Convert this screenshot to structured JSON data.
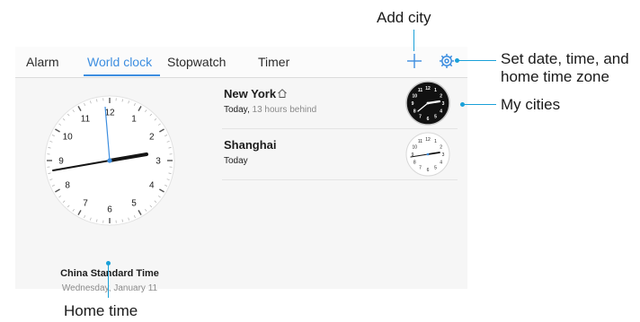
{
  "tabs": [
    {
      "label": "Alarm",
      "active": false
    },
    {
      "label": "World clock",
      "active": true
    },
    {
      "label": "Stopwatch",
      "active": false
    },
    {
      "label": "Timer",
      "active": false
    }
  ],
  "toolbar": {
    "add_icon": "plus-icon",
    "settings_icon": "gear-icon"
  },
  "home_clock": {
    "timezone": "China Standard Time",
    "date": "Wednesday, January 11",
    "numbers": [
      "12",
      "1",
      "2",
      "3",
      "4",
      "5",
      "6",
      "7",
      "8",
      "9",
      "10",
      "11"
    ]
  },
  "cities": [
    {
      "name": "New York",
      "day": "Today,",
      "offset": "13 hours behind",
      "is_home": true,
      "theme": "dark"
    },
    {
      "name": "Shanghai",
      "day": "Today",
      "offset": "",
      "is_home": false,
      "theme": "light"
    }
  ],
  "callouts": {
    "add_city": "Add city",
    "settings_line1": "Set date, time, and",
    "settings_line2": "home time zone",
    "my_cities": "My cities",
    "home_time": "Home time"
  },
  "colors": {
    "accent": "#3d8ee0",
    "callout": "#1aa0d8"
  }
}
